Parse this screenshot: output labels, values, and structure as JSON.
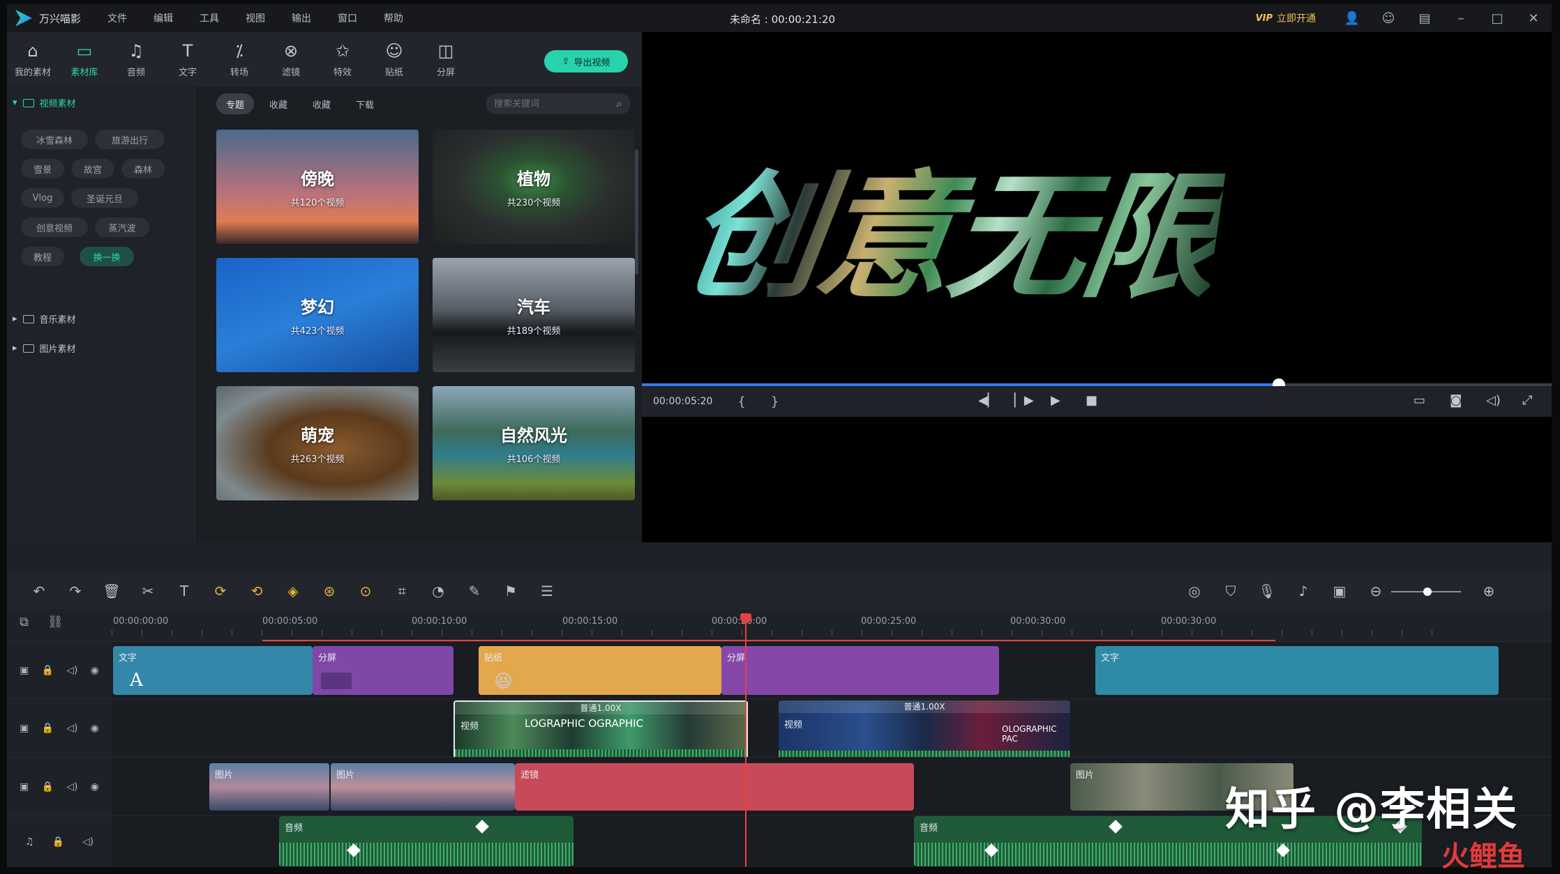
{
  "app": {
    "name": "万兴喵影",
    "title": "未命名 : 00:00:21:20"
  },
  "menu": [
    "文件",
    "编辑",
    "工具",
    "视图",
    "输出",
    "窗口",
    "帮助"
  ],
  "vip": {
    "badge": "VIP",
    "label": "立即开通"
  },
  "toolbar": [
    {
      "label": "我的素材",
      "icon": "folder-icon"
    },
    {
      "label": "素材库",
      "icon": "library-icon",
      "active": true
    },
    {
      "label": "音频",
      "icon": "music-icon"
    },
    {
      "label": "文字",
      "icon": "text-icon"
    },
    {
      "label": "转场",
      "icon": "transition-icon"
    },
    {
      "label": "滤镜",
      "icon": "filter-icon"
    },
    {
      "label": "特效",
      "icon": "effect-icon"
    },
    {
      "label": "贴纸",
      "icon": "sticker-icon"
    },
    {
      "label": "分屏",
      "icon": "split-icon"
    }
  ],
  "export_label": "导出视频",
  "sidebar": {
    "video": "视频素材",
    "music": "音乐素材",
    "image": "图片素材",
    "tags": [
      "冰雪森林",
      "旅游出行",
      "雪景",
      "故宫",
      "森林",
      "Vlog",
      "圣诞元旦",
      "创意视频",
      "蒸汽波",
      "教程",
      "换一换"
    ]
  },
  "subtabs": [
    "专题",
    "收藏",
    "收藏",
    "下载"
  ],
  "search_placeholder": "搜索关键词",
  "categories": [
    {
      "title": "傍晚",
      "count": "共120个视频"
    },
    {
      "title": "植物",
      "count": "共230个视频"
    },
    {
      "title": "梦幻",
      "count": "共423个视频"
    },
    {
      "title": "汽车",
      "count": "共189个视频"
    },
    {
      "title": "萌宠",
      "count": "共263个视频"
    },
    {
      "title": "自然风光",
      "count": "共106个视频"
    }
  ],
  "preview": {
    "text": "创意无限",
    "time": "00:00:05:20",
    "progress": 0.7
  },
  "ruler": [
    "00:00:00:00",
    "00:00:05:00",
    "00:00:10:00",
    "00:00:15:00",
    "00:00:20:00",
    "00:00:25:00",
    "00:00:30:00",
    "00:00:30:00"
  ],
  "tracks": {
    "text1": "文字",
    "split1": "分屏",
    "sticker": "贴纸",
    "split2": "分屏",
    "text2": "文字",
    "video1": "视频",
    "video2": "视频",
    "speed1": "普通1.00X",
    "speed2": "普通1.00X",
    "video1_overlay": "LOGRAPHIC OGRAPHIC",
    "video2_overlay": "OLOGRAPHIC PAC",
    "image1": "图片",
    "image2": "图片",
    "filter": "滤镜",
    "image3": "图片",
    "audio1": "音频",
    "audio2": "音频"
  },
  "watermark": {
    "main": "知乎 @李相关",
    "corner": "火鲤鱼"
  }
}
